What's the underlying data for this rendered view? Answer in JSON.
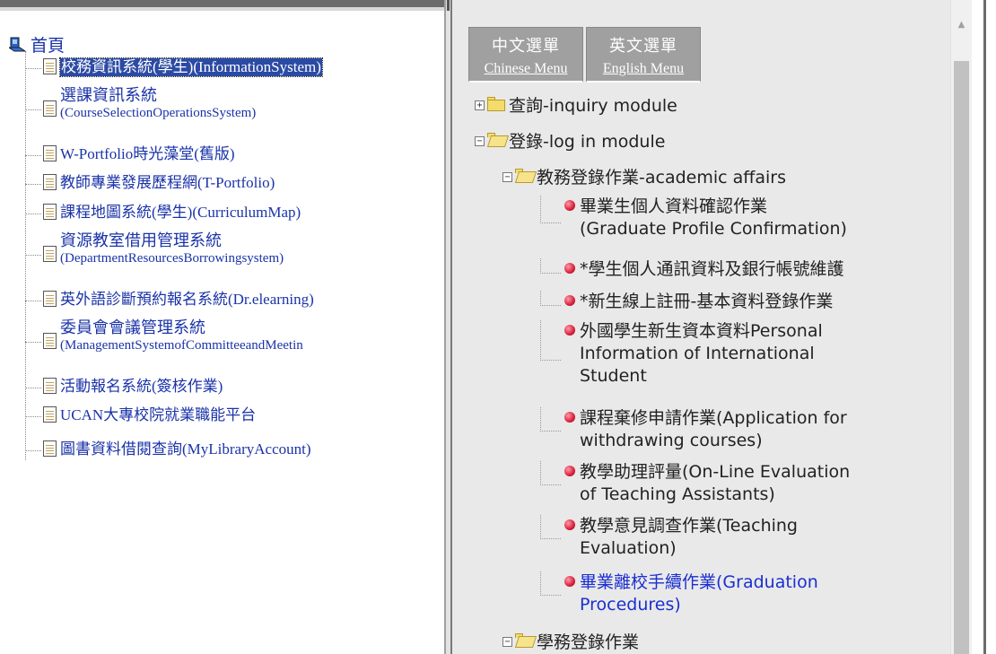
{
  "left_tree": {
    "home": "首頁",
    "items": [
      {
        "label": "校務資訊系統(學生)(InformationSystem)",
        "selected": true
      },
      {
        "line1": "選課資訊系統",
        "line2": "(CourseSelectionOperationsSystem)"
      },
      {
        "label": "W-Portfolio時光藻堂(舊版)"
      },
      {
        "label": "教師專業發展歷程網(T-Portfolio)"
      },
      {
        "label": "課程地圖系統(學生)(CurriculumMap)"
      },
      {
        "line1": "資源教室借用管理系統",
        "line2": "(DepartmentResourcesBorrowingsystem)"
      },
      {
        "label": "英外語診斷預約報名系統(Dr.elearning)"
      },
      {
        "line1": "委員會會議管理系統",
        "line2": "(ManagementSystemofCommitteeandMeetin"
      },
      {
        "label": "活動報名系統(簽核作業)"
      },
      {
        "label": "UCAN大專校院就業職能平台"
      },
      {
        "label": "圖書資料借閱查詢(MyLibraryAccount)"
      }
    ]
  },
  "menu_tabs": [
    {
      "zh": "中文選單",
      "en": "Chinese Menu"
    },
    {
      "zh": "英文選單",
      "en": "English Menu"
    }
  ],
  "right_tree": {
    "inquiry": "查詢-inquiry module",
    "login": "登錄-log in module",
    "academic": "教務登錄作業-academic affairs",
    "leaves": [
      {
        "lines": [
          "畢業生個人資料確認作業",
          "(Graduate Profile Confirmation)"
        ]
      },
      {
        "lines": [
          "*學生個人通訊資料及銀行帳號維護"
        ]
      },
      {
        "lines": [
          "*新生線上註冊-基本資料登錄作業"
        ]
      },
      {
        "lines": [
          "外國學生新生資本資料Personal",
          "Information of International",
          "Student"
        ]
      },
      {
        "lines": [
          "課程棄修申請作業(Application for",
          "withdrawing courses)"
        ]
      },
      {
        "lines": [
          "教學助理評量(On-Line Evaluation",
          "of Teaching Assistants)"
        ]
      },
      {
        "lines": [
          "教學意見調查作業(Teaching",
          "Evaluation)"
        ]
      },
      {
        "lines": [
          "畢業離校手續作業(Graduation",
          "Procedures)"
        ],
        "visited": true
      }
    ],
    "student_affairs": "學務登錄作業"
  },
  "colors": {
    "link": "#1a33a8",
    "selected_bg": "#2b4aa4",
    "visited": "#1b2fd0",
    "bullet": "#d8203a"
  }
}
